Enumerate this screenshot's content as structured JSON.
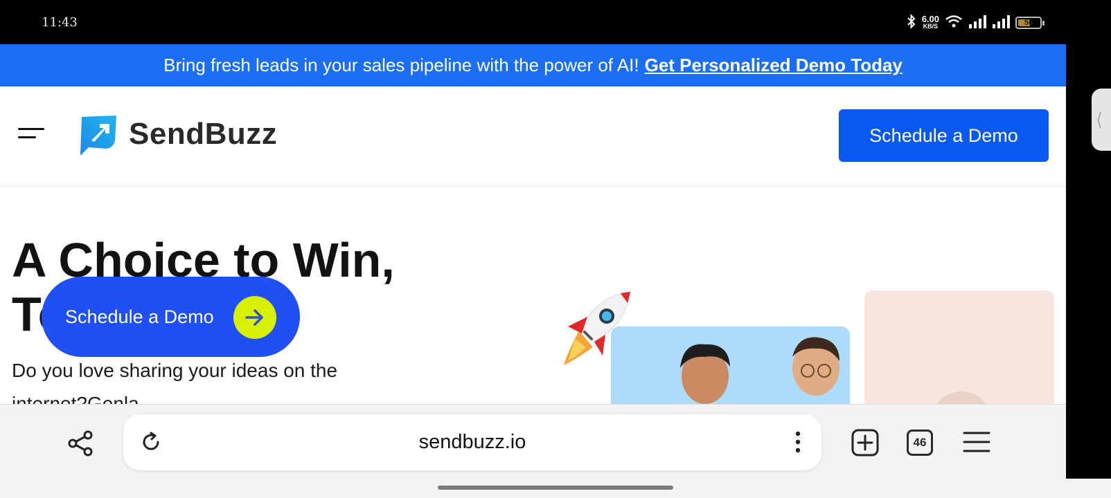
{
  "status_bar": {
    "time": "11:43",
    "net_speed_value": "6.00",
    "net_speed_unit": "KB/S",
    "battery_percent": "56",
    "battery_level": 0.56,
    "icons": [
      "bluetooth-icon",
      "wifi-icon",
      "signal-icon",
      "signal-icon",
      "battery-icon"
    ]
  },
  "promo": {
    "text": "Bring fresh leads in your sales pipeline with the power of AI!",
    "link": "Get Personalized Demo Today"
  },
  "header": {
    "logo_text": "SendBuzz",
    "cta_label": "Schedule a Demo"
  },
  "hero": {
    "title_line1": "A Choice to Win,",
    "title_line2": "To",
    "description": "Do you love sharing your ideas on the internet?Genla...",
    "floating_cta_label": "Schedule a Demo"
  },
  "browser": {
    "url": "sendbuzz.io",
    "tab_count": "46"
  },
  "colors": {
    "promo_bg": "#1b6ef3",
    "header_cta_bg": "#0759ef",
    "float_cta_bg": "#1f4ff5",
    "arrow_accent": "#d6f000"
  }
}
